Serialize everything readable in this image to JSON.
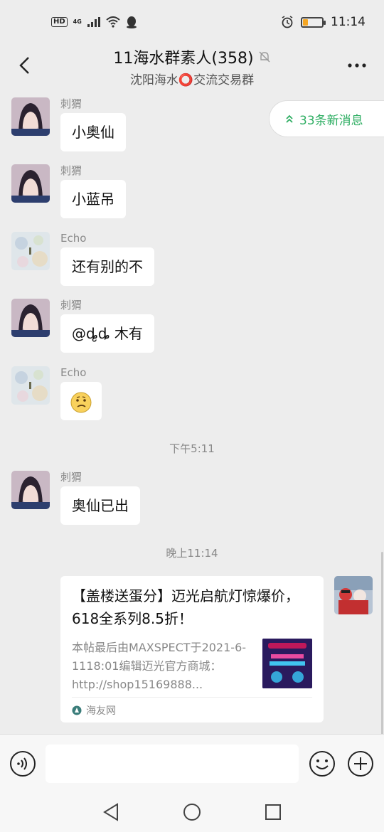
{
  "status": {
    "time": "11:14",
    "hd": "HD",
    "network": "4G",
    "battery_level": 0.25
  },
  "header": {
    "title": "11海水群素人(358)",
    "subtitle": "沈阳海水⭕交流交易群"
  },
  "new_messages": {
    "label": "33条新消息"
  },
  "messages": [
    {
      "sender": "刺猬",
      "text": "小奥仙"
    },
    {
      "sender": "刺猬",
      "text": "小蓝吊"
    },
    {
      "sender": "Echo",
      "text": "还有别的不"
    },
    {
      "sender": "刺猬",
      "text": "@ȡ̮ȡ 木有"
    },
    {
      "sender": "Echo",
      "text": "🤔"
    },
    {
      "sender": "刺猬",
      "text": "奥仙已出"
    }
  ],
  "timestamps": [
    "下午5:11",
    "晚上11:14"
  ],
  "link_card": {
    "title": "【盖楼送蛋分】迈光启航灯惊爆价，618全系列8.5折！",
    "description": "本帖最后由MAXSPECT于2021-6-1118:01编辑迈光官方商城：http://shop15169888...",
    "source": "海友网"
  },
  "input": {
    "placeholder": ""
  },
  "colors": {
    "accent_green": "#2fae63",
    "background": "#ededed",
    "bubble": "#ffffff"
  }
}
